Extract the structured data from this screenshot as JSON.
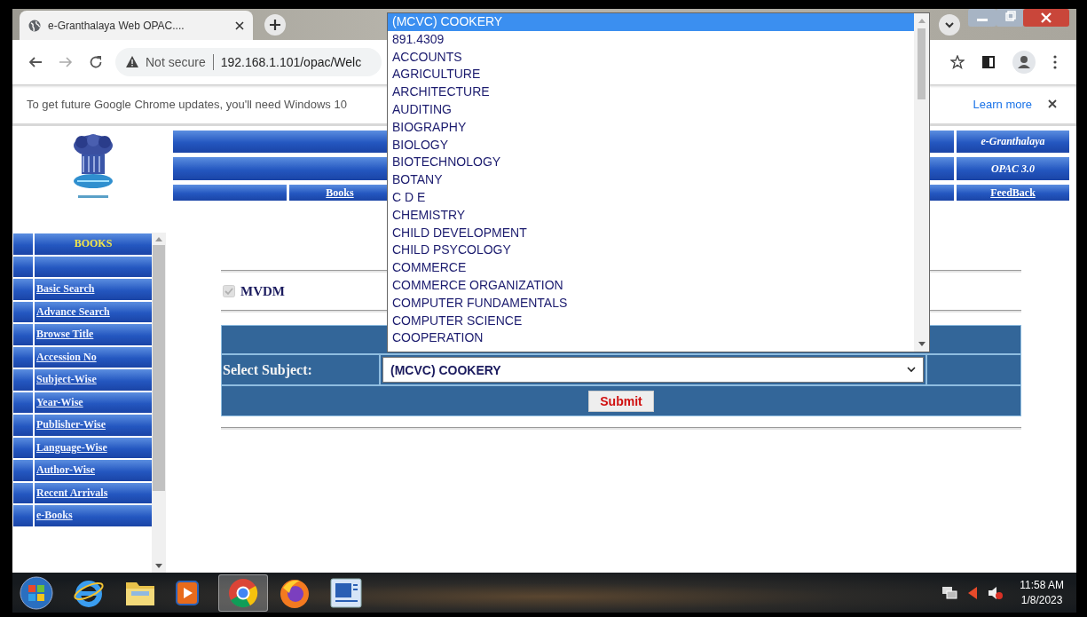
{
  "browser": {
    "tab": {
      "title": "e-Granthalaya Web OPAC...."
    },
    "address": {
      "security": "Not secure",
      "url": "192.168.1.101/opac/Welc"
    },
    "infobar": {
      "message": "To get future Google Chrome updates, you'll need Windows 10",
      "link": "Learn more"
    }
  },
  "header": {
    "nav_links": [
      "Books"
    ],
    "right_items": [
      {
        "label": "e-Granthalaya",
        "kind": "title"
      },
      {
        "label": "OPAC 3.0",
        "kind": "title"
      },
      {
        "label": "FeedBack",
        "kind": "link"
      }
    ]
  },
  "sidebar": {
    "title": "BOOKS",
    "items": [
      "Basic Search",
      "Advance Search",
      "Browse Title",
      "Accession No",
      "Subject-Wise",
      "Year-Wise",
      "Publisher-Wise",
      "Language-Wise",
      "Author-Wise",
      "Recent Arrivals",
      "e-Books"
    ]
  },
  "form": {
    "library": {
      "label": "MVDM",
      "checked": true,
      "disabled": true
    },
    "subject_label": "Select Subject:",
    "subject_value": "(MCVC) COOKERY",
    "submit": "Submit"
  },
  "dropdown": {
    "options": [
      {
        "label": "(MCVC) COOKERY",
        "selected": true
      },
      {
        "label": "891.4309",
        "selected": false
      },
      {
        "label": "ACCOUNTS",
        "selected": false
      },
      {
        "label": "AGRICULTURE",
        "selected": false
      },
      {
        "label": "ARCHITECTURE",
        "selected": false
      },
      {
        "label": "AUDITING",
        "selected": false
      },
      {
        "label": "BIOGRAPHY",
        "selected": false
      },
      {
        "label": "BIOLOGY",
        "selected": false
      },
      {
        "label": "BIOTECHNOLOGY",
        "selected": false
      },
      {
        "label": "BOTANY",
        "selected": false
      },
      {
        "label": "C D E",
        "selected": false
      },
      {
        "label": "CHEMISTRY",
        "selected": false
      },
      {
        "label": "CHILD DEVELOPMENT",
        "selected": false
      },
      {
        "label": "CHILD PSYCOLOGY",
        "selected": false
      },
      {
        "label": "COMMERCE",
        "selected": false
      },
      {
        "label": "COMMERCE ORGANIZATION",
        "selected": false
      },
      {
        "label": "COMPUTER FUNDAMENTALS",
        "selected": false
      },
      {
        "label": "COMPUTER SCIENCE",
        "selected": false
      },
      {
        "label": "COOPERATION",
        "selected": false
      }
    ]
  },
  "taskbar": {
    "time": "11:58 AM",
    "date": "1/8/2023"
  }
}
